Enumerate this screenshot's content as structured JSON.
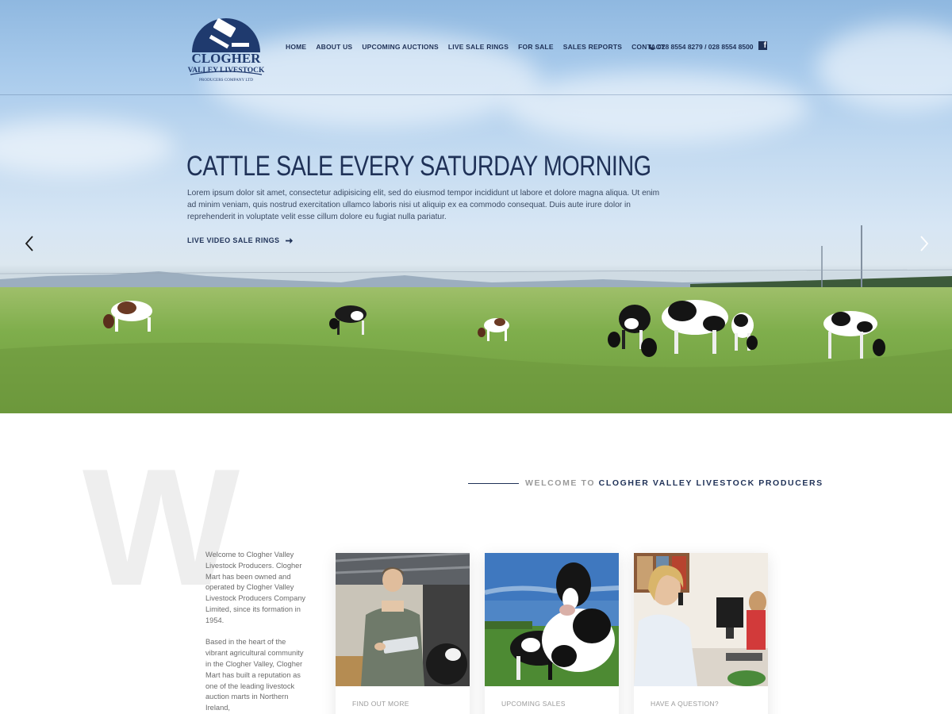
{
  "brand": {
    "logo_name": "CLOGHER",
    "logo_sub": "VALLEY LIVESTOCK",
    "logo_tag": "PRODUCERS COMPANY LTD"
  },
  "nav": {
    "items": [
      "HOME",
      "ABOUT US",
      "UPCOMING AUCTIONS",
      "LIVE SALE RINGS",
      "FOR SALE",
      "SALES REPORTS",
      "CONTACT"
    ],
    "phone": "028 8554 8279 / 028 8554 8500",
    "facebook_icon": "facebook-icon"
  },
  "hero": {
    "title": "CATTLE SALE EVERY SATURDAY MORNING",
    "text": "Lorem ipsum dolor sit amet, consectetur adipisicing elit, sed do eiusmod tempor incididunt ut labore et dolore magna aliqua. Ut enim ad minim veniam, quis nostrud exercitation ullamco laboris nisi ut aliquip ex ea commodo consequat. Duis aute irure dolor in reprehenderit in voluptate velit esse cillum dolore eu fugiat nulla pariatur.",
    "cta": "LIVE VIDEO SALE RINGS",
    "prev_icon": "chevron-left-icon",
    "next_icon": "chevron-right-icon"
  },
  "welcome": {
    "big_letter": "W",
    "heading_pre": "WELCOME TO",
    "heading_main": "CLOGHER VALLEY LIVESTOCK PRODUCERS",
    "para1": "Welcome to Clogher Valley Livestock Producers. Clogher Mart has been owned and operated by Clogher Valley Livestock Producers Company Limited, since its formation in 1954.",
    "para2": "Based in the heart of the vibrant agricultural community in the Clogher Valley, Clogher Mart has built a reputation as one of the leading livestock auction marts in Northern Ireland,"
  },
  "cards": [
    {
      "label": "FIND OUT MORE"
    },
    {
      "label": "UPCOMING SALES"
    },
    {
      "label": "HAVE A QUESTION?"
    }
  ],
  "colors": {
    "brand_navy": "#1f3157",
    "muted_text": "#9a9a9a",
    "grass": "#7aa84a",
    "sky": "#a9cbec"
  }
}
